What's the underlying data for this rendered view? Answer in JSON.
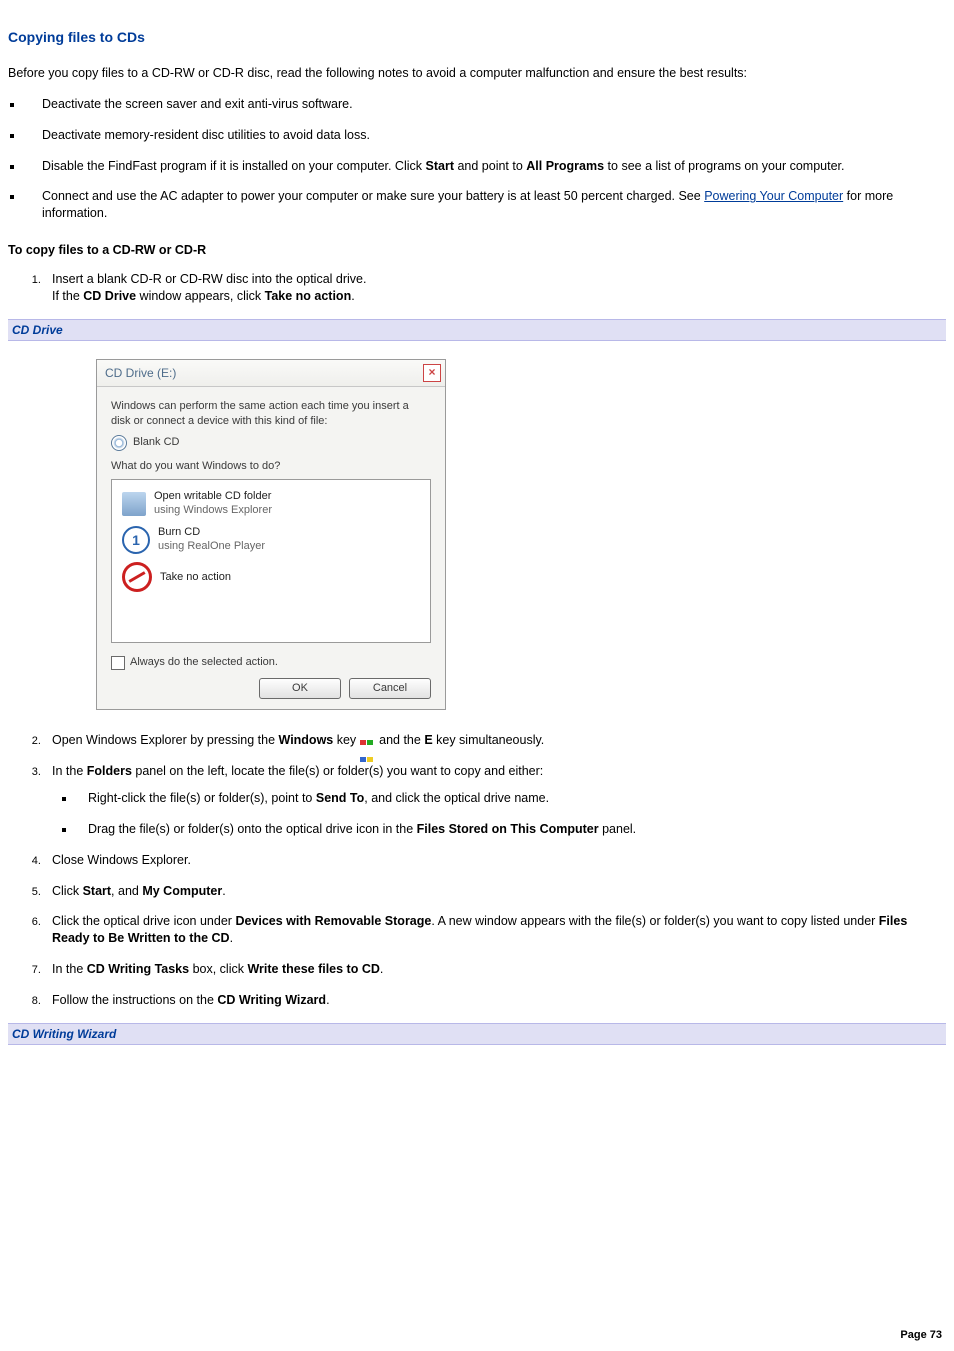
{
  "title": "Copying files to CDs",
  "intro": "Before you copy files to a CD-RW or CD-R disc, read the following notes to avoid a computer malfunction and ensure the best results:",
  "bullets": [
    {
      "text": "Deactivate the screen saver and exit anti-virus software."
    },
    {
      "text": "Deactivate memory-resident disc utilities to avoid data loss."
    },
    {
      "pre": "Disable the FindFast program if it is installed on your computer. Click ",
      "bold1": "Start",
      "mid1": " and point to ",
      "bold2": "All Programs",
      "post": " to see a list of programs on your computer."
    },
    {
      "pre": "Connect and use the AC adapter to power your computer or make sure your battery is at least 50 percent charged. See ",
      "link": "Powering Your Computer",
      "post": " for more information."
    }
  ],
  "subhead": "To copy files to a CD-RW or CD-R",
  "step1": {
    "line1": "Insert a blank CD-R or CD-RW disc into the optical drive.",
    "line2a": "If the ",
    "line2bold1": "CD Drive",
    "line2b": " window appears, click ",
    "line2bold2": "Take no action",
    "line2c": "."
  },
  "caption1": "CD Drive",
  "dialog": {
    "title": "CD Drive (E:)",
    "intro": "Windows can perform the same action each time you insert a disk or connect a device with this kind of file:",
    "blankcd": "Blank CD",
    "question": "What do you want Windows to do?",
    "options": [
      {
        "icon": "folder",
        "title": "Open writable CD folder",
        "sub": "using Windows Explorer"
      },
      {
        "icon": "burn",
        "title": "Burn CD",
        "sub": "using RealOne Player"
      },
      {
        "icon": "noact",
        "title": "Take no action",
        "sub": ""
      }
    ],
    "checkbox": "Always do the selected action.",
    "ok": "OK",
    "cancel": "Cancel"
  },
  "step2": {
    "pre": "Open Windows Explorer by pressing the ",
    "bold1": "Windows",
    "mid1": " key ",
    "mid2": " and the ",
    "bold2": "E",
    "post": " key simultaneously."
  },
  "step3": {
    "pre": "In the ",
    "bold1": "Folders",
    "post": " panel on the left, locate the file(s) or folder(s) you want to copy and either:",
    "sub1pre": "Right-click the file(s) or folder(s), point to ",
    "sub1bold": "Send To",
    "sub1mid": ", and click the optical drive",
    "sub1post": " name.",
    "sub2pre": "Drag the file(s) or folder(s) onto the optical drive icon in the ",
    "sub2bold": "Files Stored on This Computer",
    "sub2post": " panel."
  },
  "step4": "Close Windows Explorer.",
  "step5": {
    "pre": "Click ",
    "b1": "Start",
    "mid": ", and ",
    "b2": "My Computer",
    "post": "."
  },
  "step6": {
    "pre": "Click the optical drive icon under ",
    "b1": "Devices with Removable Storage",
    "mid": ". A new window appears with the file(s) or folder(s) you want to copy listed under ",
    "b2": "Files Ready to Be Written to the CD",
    "post": "."
  },
  "step7": {
    "pre": "In the ",
    "b1": "CD Writing Tasks",
    "mid": " box, click ",
    "b2": "Write these files to CD",
    "post": "."
  },
  "step8": {
    "pre": "Follow the instructions on the ",
    "b1": "CD Writing Wizard",
    "post": "."
  },
  "caption2": "CD Writing Wizard",
  "pagenum": "Page 73"
}
